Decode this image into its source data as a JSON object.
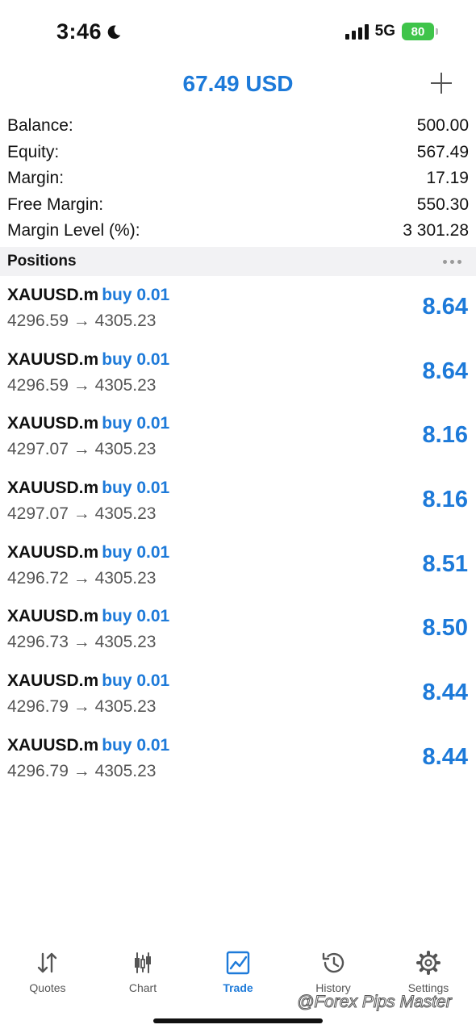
{
  "status_bar": {
    "time": "3:46",
    "network": "5G",
    "battery": "80"
  },
  "header": {
    "title": "67.49 USD"
  },
  "summary": [
    {
      "label": "Balance:",
      "value": "500.00"
    },
    {
      "label": "Equity:",
      "value": "567.49"
    },
    {
      "label": "Margin:",
      "value": "17.19"
    },
    {
      "label": "Free Margin:",
      "value": "550.30"
    },
    {
      "label": "Margin Level (%):",
      "value": "3 301.28"
    }
  ],
  "positions_section": {
    "title": "Positions"
  },
  "positions": [
    {
      "symbol": "XAUUSD.m",
      "side": "buy 0.01",
      "prices": "4296.59 → 4305.23",
      "profit": "8.64"
    },
    {
      "symbol": "XAUUSD.m",
      "side": "buy 0.01",
      "prices": "4296.59 → 4305.23",
      "profit": "8.64"
    },
    {
      "symbol": "XAUUSD.m",
      "side": "buy 0.01",
      "prices": "4297.07 → 4305.23",
      "profit": "8.16"
    },
    {
      "symbol": "XAUUSD.m",
      "side": "buy 0.01",
      "prices": "4297.07 → 4305.23",
      "profit": "8.16"
    },
    {
      "symbol": "XAUUSD.m",
      "side": "buy 0.01",
      "prices": "4296.72 → 4305.23",
      "profit": "8.51"
    },
    {
      "symbol": "XAUUSD.m",
      "side": "buy 0.01",
      "prices": "4296.73 → 4305.23",
      "profit": "8.50"
    },
    {
      "symbol": "XAUUSD.m",
      "side": "buy 0.01",
      "prices": "4296.79 → 4305.23",
      "profit": "8.44"
    },
    {
      "symbol": "XAUUSD.m",
      "side": "buy 0.01",
      "prices": "4296.79 → 4305.23",
      "profit": "8.44"
    }
  ],
  "tabs": [
    {
      "label": "Quotes",
      "icon": "quotes-icon",
      "active": false
    },
    {
      "label": "Chart",
      "icon": "chart-icon",
      "active": false
    },
    {
      "label": "Trade",
      "icon": "trade-icon",
      "active": true
    },
    {
      "label": "History",
      "icon": "history-icon",
      "active": false
    },
    {
      "label": "Settings",
      "icon": "settings-icon",
      "active": false
    }
  ],
  "watermark": "@Forex Pips Master",
  "colors": {
    "accent": "#1d7ad9",
    "battery": "#3fc44a",
    "section_bg": "#f2f2f4"
  }
}
